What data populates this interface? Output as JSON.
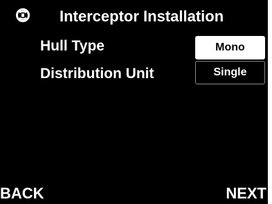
{
  "header": {
    "icon": "propeller-settings-icon",
    "title": "Interceptor Installation"
  },
  "rows": [
    {
      "label": "Hull Type",
      "value": "Mono",
      "selected": true
    },
    {
      "label": "Distribution Unit",
      "value": "Single",
      "selected": false
    }
  ],
  "softkeys": {
    "back": "BACK",
    "next": "NEXT"
  },
  "colors": {
    "background": "#000000",
    "text": "#ffffff",
    "selected_fill": "#ffffff",
    "unselected_border": "#8a8a8a"
  }
}
